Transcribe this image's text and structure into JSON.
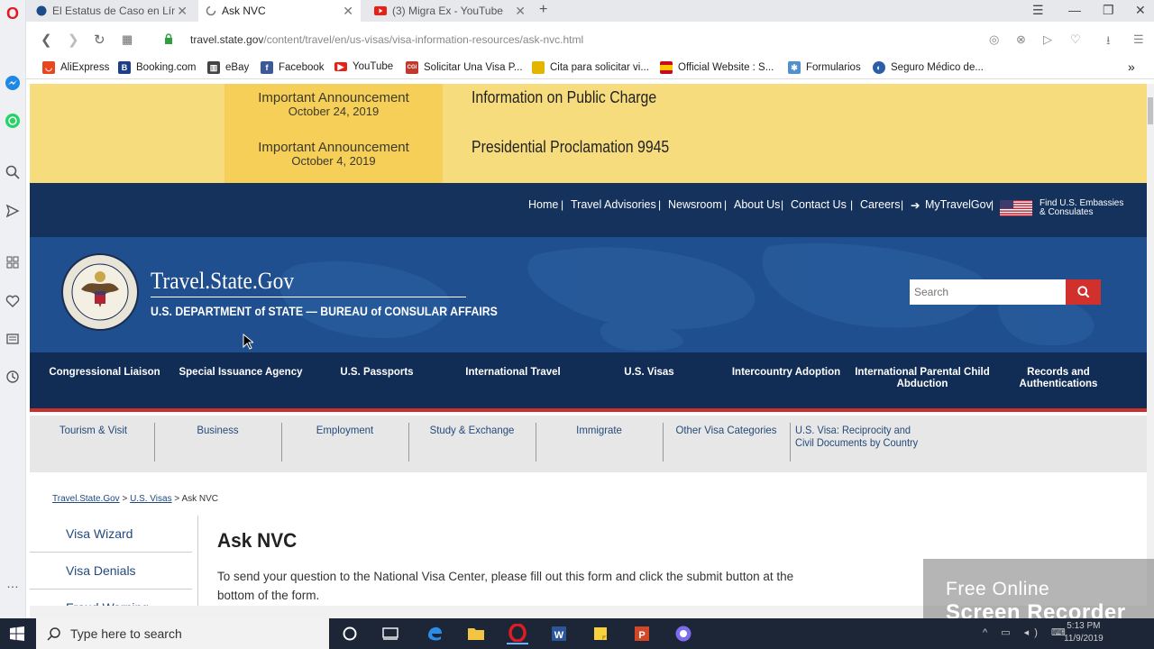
{
  "browser": {
    "tabs": [
      {
        "label": "El Estatus de Caso en Línea",
        "active": false
      },
      {
        "label": "Ask NVC",
        "active": true
      },
      {
        "label": "(3) Migra Ex - YouTube",
        "active": false
      }
    ],
    "url_host": "travel.state.gov",
    "url_path": "/content/travel/en/us-visas/visa-information-resources/ask-nvc.html",
    "bookmarks": [
      {
        "label": "AliExpress",
        "icon": "aliexpress-icon",
        "color": "#e8461d"
      },
      {
        "label": "Booking.com",
        "icon": "booking-icon",
        "color": "#1c3f8a"
      },
      {
        "label": "eBay",
        "icon": "ebay-icon",
        "color": "#333"
      },
      {
        "label": "Facebook",
        "icon": "facebook-icon",
        "color": "#3b5998"
      },
      {
        "label": "YouTube",
        "icon": "youtube-icon",
        "color": "#e62117"
      },
      {
        "label": "Solicitar Una Visa P...",
        "icon": "cgi-icon",
        "color": "#c0392b"
      },
      {
        "label": "Cita para solicitar vi...",
        "icon": "folder-icon",
        "color": "#e3b400"
      },
      {
        "label": "Official Website : S...",
        "icon": "spain-flag-icon",
        "color": "#c60b1e"
      },
      {
        "label": "Formularios",
        "icon": "joomla-icon",
        "color": "#5091cd"
      },
      {
        "label": "Seguro Médico de...",
        "icon": "globe-icon",
        "color": "#2c5ea8"
      }
    ]
  },
  "announcements": [
    {
      "label": "Important Announcement",
      "date": "October 24, 2019",
      "title": "Information on Public Charge"
    },
    {
      "label": "Important Announcement",
      "date": "October 4, 2019",
      "title": "Presidential Proclamation 9945"
    }
  ],
  "util_nav": [
    "Home",
    "Travel Advisories",
    "Newsroom",
    "About Us",
    "Contact Us",
    "Careers",
    "MyTravelGov"
  ],
  "embassy_link": [
    "Find U.S. Embassies",
    "& Consulates"
  ],
  "site": {
    "title": "Travel.State.Gov",
    "subtitle": "U.S. DEPARTMENT of STATE — BUREAU of CONSULAR AFFAIRS",
    "search_placeholder": "Search"
  },
  "main_nav": [
    "Congressional Liaison",
    "Special Issuance Agency",
    "U.S. Passports",
    "International Travel",
    "U.S. Visas",
    "Intercountry Adoption",
    "International Parental Child Abduction",
    "Records and Authentications"
  ],
  "sub_nav": [
    "Tourism & Visit",
    "Business",
    "Employment",
    "Study & Exchange",
    "Immigrate",
    "Other Visa Categories"
  ],
  "sub_nav_last": [
    "U.S. Visa: Reciprocity and",
    "Civil Documents by Country"
  ],
  "breadcrumb": [
    "Travel.State.Gov",
    "U.S. Visas",
    "Ask NVC"
  ],
  "left_menu": [
    "Visa Wizard",
    "Visa Denials",
    "Fraud Warning"
  ],
  "content": {
    "title": "Ask NVC",
    "body": "To send your question to the National Visa Center, please fill out this form and click the submit button at the bottom of the form."
  },
  "watermark": [
    "Free Online",
    "Screen Recorder"
  ],
  "taskbar": {
    "search_placeholder": "Type here to search",
    "time": "5:13 PM",
    "date": "11/9/2019"
  },
  "colors": {
    "announce_bg": "#f7dc7e",
    "header_bg": "#1f4f8e",
    "nav_bg": "#112c55",
    "accent_red": "#d0312d"
  }
}
